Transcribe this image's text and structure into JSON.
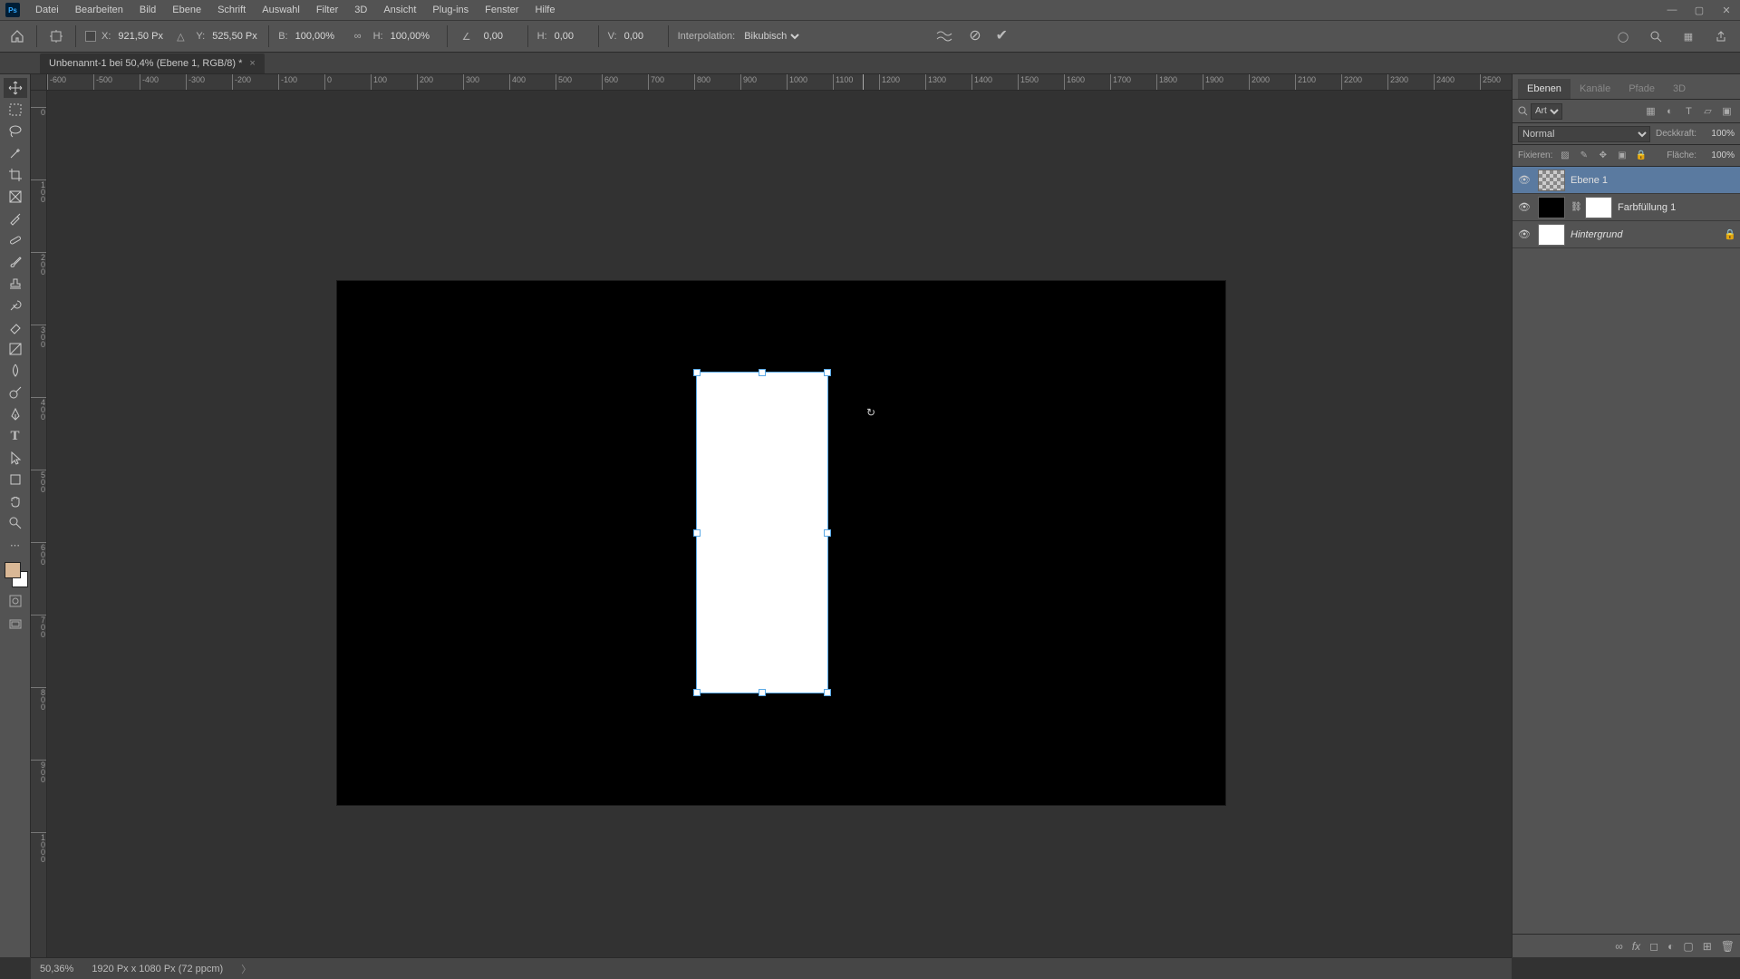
{
  "menu": [
    "Datei",
    "Bearbeiten",
    "Bild",
    "Ebene",
    "Schrift",
    "Auswahl",
    "Filter",
    "3D",
    "Ansicht",
    "Plug-ins",
    "Fenster",
    "Hilfe"
  ],
  "options": {
    "x_lbl": "X:",
    "x": "921,50 Px",
    "y_lbl": "Y:",
    "y": "525,50 Px",
    "w_lbl": "B:",
    "w": "100,00%",
    "h_lbl": "H:",
    "h": "100,00%",
    "rot_lbl": "",
    "rot": "0,00",
    "hskew_lbl": "H:",
    "hskew": "0,00",
    "vskew_lbl": "V:",
    "vskew": "0,00",
    "interp_lbl": "Interpolation:",
    "interp": "Bikubisch"
  },
  "tab": {
    "title": "Unbenannt-1 bei 50,4% (Ebene 1, RGB/8) *"
  },
  "hruler": [
    "-600",
    "-500",
    "-400",
    "-300",
    "-200",
    "-100",
    "0",
    "100",
    "200",
    "300",
    "400",
    "500",
    "600",
    "700",
    "800",
    "900",
    "1000",
    "1100",
    "1200",
    "1300",
    "1400",
    "1500",
    "1600",
    "1700",
    "1800",
    "1900",
    "2000",
    "2100",
    "2200",
    "2300",
    "2400",
    "2500"
  ],
  "vruler": [
    "0",
    "100",
    "200",
    "300",
    "400",
    "500",
    "600",
    "700",
    "800",
    "900",
    "1000"
  ],
  "panels": {
    "tabs": [
      "Ebenen",
      "Kanäle",
      "Pfade",
      "3D"
    ],
    "filter_label": "Art",
    "blend": "Normal",
    "opacity_lbl": "Deckkraft:",
    "opacity": "100%",
    "lock_lbl": "Fixieren:",
    "fill_lbl": "Fläche:",
    "fill": "100%",
    "layers": [
      {
        "name": "Ebene 1",
        "type": "checker",
        "sel": true
      },
      {
        "name": "Farbfüllung 1",
        "type": "black",
        "mask": true
      },
      {
        "name": "Hintergrund",
        "type": "white",
        "italic": true,
        "locked": true
      }
    ]
  },
  "status": {
    "zoom": "50,36%",
    "docinfo": "1920 Px x 1080 Px (72 ppcm)"
  }
}
